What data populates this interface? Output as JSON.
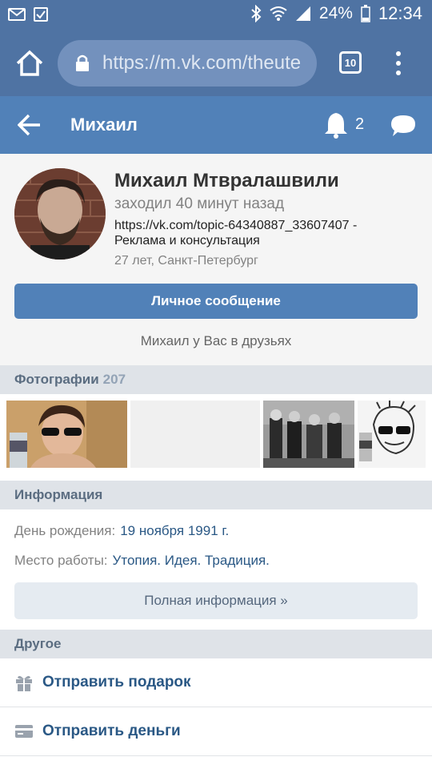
{
  "status_bar": {
    "battery": "24%",
    "time": "12:34"
  },
  "browser": {
    "url": "https://m.vk.com/theute",
    "tab_count": "10"
  },
  "header": {
    "title": "Михаил",
    "notifications_count": "2"
  },
  "profile": {
    "name": "Михаил Мтвралашвили",
    "last_seen": "заходил 40 минут назад",
    "status_line1": "https://vk.com/topic-64340887_33607407 -",
    "status_line2": "Реклама и консультация",
    "details": "27 лет, Санкт-Петербург",
    "message_button": "Личное сообщение",
    "friend_note": "Михаил у Вас в друзьях"
  },
  "photos": {
    "title": "Фотографии",
    "count": "207"
  },
  "info": {
    "title": "Информация",
    "birthday_label": "День рождения:",
    "birthday_value": "19 ноября 1991 г.",
    "work_label": "Место работы:",
    "work_value": "Утопия. Идея. Традиция.",
    "full_info_button": "Полная информация »"
  },
  "other": {
    "title": "Другое",
    "send_gift": "Отправить подарок",
    "send_money": "Отправить деньги"
  },
  "colors": {
    "status_bar": "#4f73a3",
    "vk_header": "#5181b8",
    "link": "#2a5885",
    "section_bg": "#dfe3e8"
  }
}
